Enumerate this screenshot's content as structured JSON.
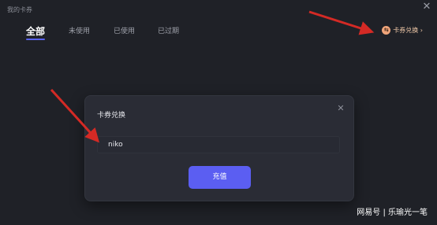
{
  "window": {
    "title": "我的卡券",
    "close_icon": "close-icon"
  },
  "tabs": [
    {
      "label": "全部",
      "active": true
    },
    {
      "label": "未使用",
      "active": false
    },
    {
      "label": "已使用",
      "active": false
    },
    {
      "label": "已过期",
      "active": false
    }
  ],
  "redeem": {
    "label": "卡券兑换 ›",
    "icon": "exchange-icon"
  },
  "dialog": {
    "title": "卡券兑换",
    "input_value": "niko",
    "button_label": "充值",
    "close_icon": "close-icon"
  },
  "watermark": "网易号 | 乐瑜光一笔",
  "colors": {
    "background": "#1f2127",
    "dialog_bg": "#2a2c35",
    "accent": "#5b5ef2",
    "redeem_text": "#f0c9a8",
    "annotation_arrow": "#d42a25"
  }
}
